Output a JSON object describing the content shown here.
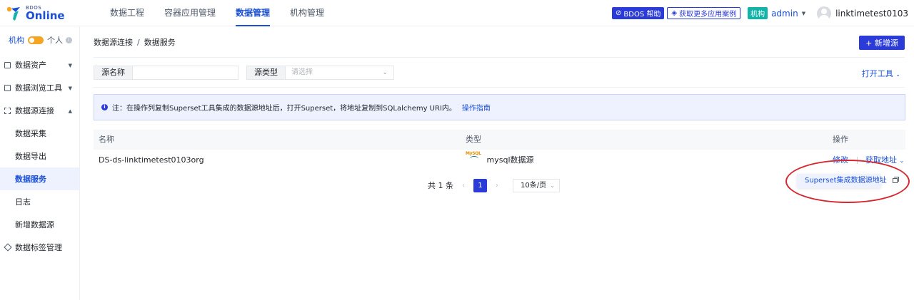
{
  "header": {
    "logo_small": "BDOS",
    "logo_big": "Online",
    "nav": [
      "数据工程",
      "容器应用管理",
      "数据管理",
      "机构管理"
    ],
    "active_nav": "数据管理",
    "help_label": "BDOS 帮助",
    "more_label": "获取更多应用案例",
    "org_badge": "机构",
    "admin_label": "admin",
    "username": "linktimetest0103"
  },
  "sidebar": {
    "switch_org": "机构",
    "switch_personal": "个人",
    "groups": [
      {
        "label": "数据资产"
      },
      {
        "label": "数据浏览工具"
      },
      {
        "label": "数据源连接"
      }
    ],
    "subs": [
      "数据采集",
      "数据导出",
      "数据服务",
      "日志",
      "新增数据源"
    ],
    "active_sub": "数据服务",
    "tag_mgmt": "数据标签管理"
  },
  "main": {
    "breadcrumb": [
      "数据源连接",
      "数据服务"
    ],
    "new_button": "+ 新增源",
    "filter": {
      "name_label": "源名称",
      "name_value": "",
      "type_label": "源类型",
      "type_placeholder": "请选择"
    },
    "open_tool": "打开工具",
    "notice_text": "注：在操作列复制Superset工具集成的数据源地址后，打开Superset，将地址复制到SQLalchemy URI内。",
    "notice_link": "操作指南",
    "table": {
      "headers": [
        "名称",
        "类型",
        "操作"
      ],
      "rows": [
        {
          "name": "DS-ds-linktimetest0103org",
          "type_logo": "MySQL",
          "type": "mysql数据源",
          "action_edit": "修改",
          "action_get": "获取地址"
        }
      ]
    },
    "pager": {
      "total": "共 1 条",
      "current": "1",
      "page_size": "10条/页"
    },
    "dropdown_item": "Superset集成数据源地址"
  },
  "colors": {
    "primary": "#2a3bd8",
    "accent_teal": "#12b3a8",
    "toggle": "#f5a524",
    "annotation_red": "#d6262e"
  }
}
